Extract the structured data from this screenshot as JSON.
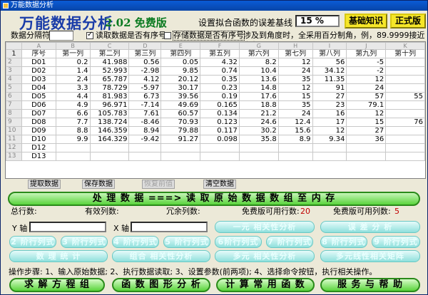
{
  "window": {
    "title": "万能数据分析"
  },
  "header": {
    "app_title": "万能数据分析",
    "version": "2.02 免费版",
    "error_label": "设置拟合函数的误差基线",
    "error_value": "15 %",
    "basic_btn": "基础知识",
    "pro_btn": "正式版"
  },
  "options": {
    "separator_label": "数据分隔符",
    "separator_value": "",
    "read_serial_label": "读取数据是否有序号",
    "read_serial_checked": true,
    "save_serial_label": "存储数据是否有序号",
    "save_serial_checked": false,
    "note": "涉及到角度时，全采用百分制角，例，89.9999接近直角。"
  },
  "grid": {
    "letters": [
      "",
      "A",
      "B",
      "C",
      "D",
      "E",
      "F",
      "G",
      "H",
      "I",
      "J",
      "K"
    ],
    "headers": [
      "",
      "序号",
      "第一列",
      "第二列",
      "第三列",
      "第四列",
      "第五列",
      "第六列",
      "第七列",
      "第八列",
      "第九列",
      "第十列"
    ],
    "rows": [
      [
        "2",
        "D01",
        "0.2",
        "41.988",
        "0.56",
        "0.05",
        "4.32",
        "8.2",
        "12",
        "56",
        "-5",
        ""
      ],
      [
        "3",
        "D02",
        "1.4",
        "52.993",
        "-2.98",
        "9.85",
        "0.74",
        "10.4",
        "24",
        "34.12",
        "-2",
        ""
      ],
      [
        "4",
        "D03",
        "2.4",
        "65.787",
        "4.12",
        "20.12",
        "0.35",
        "13.6",
        "35",
        "11.35",
        "12",
        ""
      ],
      [
        "5",
        "D04",
        "3.3",
        "78.729",
        "-5.97",
        "30.17",
        "0.23",
        "14.8",
        "12",
        "91",
        "24",
        ""
      ],
      [
        "6",
        "D05",
        "4.4",
        "81.983",
        "6.73",
        "39.56",
        "0.19",
        "17.6",
        "15",
        "27",
        "57",
        "55"
      ],
      [
        "7",
        "D06",
        "4.9",
        "96.971",
        "-7.14",
        "49.69",
        "0.165",
        "18.8",
        "35",
        "23",
        "79.1",
        ""
      ],
      [
        "8",
        "D07",
        "6.6",
        "105.783",
        "7.61",
        "60.57",
        "0.134",
        "21.2",
        "24",
        "16",
        "12",
        ""
      ],
      [
        "9",
        "D08",
        "7.7",
        "138.724",
        "-8.46",
        "70.93",
        "0.123",
        "24.6",
        "12.4",
        "17",
        "15",
        "76"
      ],
      [
        "10",
        "D09",
        "8.8",
        "146.359",
        "8.94",
        "79.88",
        "0.117",
        "30.2",
        "15.6",
        "12",
        "27",
        ""
      ],
      [
        "11",
        "D10",
        "9.9",
        "164.329",
        "-9.42",
        "91.27",
        "0.098",
        "35.8",
        "8.9",
        "9.34",
        "36",
        ""
      ],
      [
        "12",
        "D12",
        "",
        "",
        "",
        "",
        "",
        "",
        "",
        "",
        "",
        ""
      ],
      [
        "13",
        "D13",
        "",
        "",
        "",
        "",
        "",
        "",
        "",
        "",
        "",
        ""
      ]
    ]
  },
  "grid_buttons": {
    "fetch": "提取数据",
    "save": "保存数据",
    "restore": "恢复前值",
    "clear": "清空数据"
  },
  "process_btn": "处 理 数 据 ===> 读 取 原 始 数 据 数 组 至 内 存",
  "stats": {
    "total_rows": "总行数:",
    "valid_cols": "有效列数:",
    "redundant_cols": "冗余列数:",
    "free_rows_label": "免费版可用行数:",
    "free_rows_value": "20",
    "free_cols_label": "免费版可用列数:",
    "free_cols_value": "5"
  },
  "axes": {
    "y_label": "Y 轴",
    "x_label": "X 轴"
  },
  "analysis_buttons": {
    "unary": "一元 相关性分析",
    "error": "误 差 分 析",
    "col2": "2 阶行列式",
    "col3": "3 阶行列式",
    "col4": "4 阶行列式",
    "col5": "5 阶行列式",
    "col6": "6阶行列式",
    "col7": "7 阶行列式",
    "col8": "8 阶行列式",
    "col9": "9 阶行列式",
    "stats": "数 理 统 计",
    "combo": "组合 相关性分析",
    "multi": "多元 相关性分析",
    "multi_matrix": "多元线性相关矩阵"
  },
  "steps": "操作步骤: 1、输入原始数据; 2、执行数据读取; 3、设置参数(前两项); 4、选择命令按钮，执行相关操作。",
  "bottom_buttons": {
    "solve": "求 解 方 程 组",
    "plot": "函 数 图 形 分 析",
    "calc": "计 算 常 用 函 数",
    "help": "服 务 与 帮 助"
  }
}
